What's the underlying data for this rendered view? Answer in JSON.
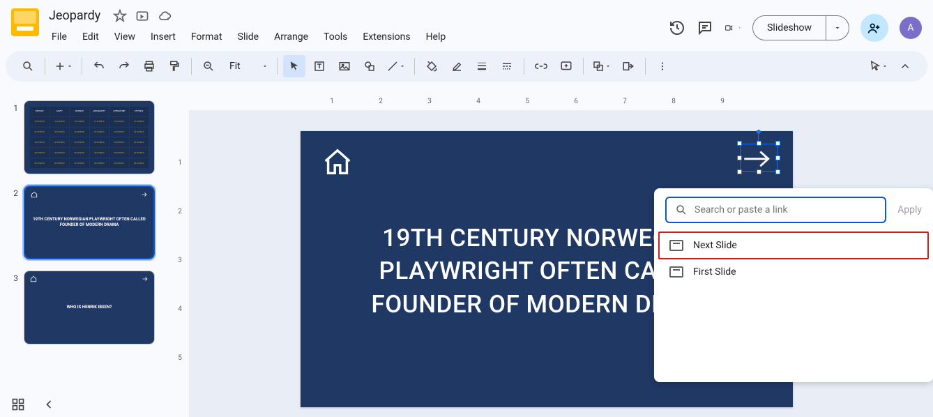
{
  "doc": {
    "title": "Jeopardy"
  },
  "menu": {
    "items": [
      "File",
      "Edit",
      "View",
      "Insert",
      "Format",
      "Slide",
      "Arrange",
      "Tools",
      "Extensions",
      "Help"
    ]
  },
  "header": {
    "slideshow": "Slideshow",
    "avatar_letter": "A"
  },
  "toolbar": {
    "zoom": "Fit"
  },
  "filmstrip": {
    "slides": [
      {
        "num": "1",
        "type": "board",
        "categories": [
          "HISTORY",
          "MATH",
          "SCIENCE",
          "GEOGRAPHY",
          "LITERATURE",
          "PHYSICS"
        ],
        "points": [
          "10 POINTS",
          "20 POINTS",
          "30 POINTS",
          "40 POINTS",
          "50 POINTS"
        ]
      },
      {
        "num": "2",
        "type": "clue",
        "text": "19TH CENTURY NORWEGIAN PLAYWRIGHT OFTEN CALLED FOUNDER OF MODERN DRAMA",
        "selected": true
      },
      {
        "num": "3",
        "type": "answer",
        "text": "WHO IS HENRIK IBSEN?"
      }
    ]
  },
  "slide": {
    "title_text": "19TH CENTURY NORWEGIAN PLAYWRIGHT OFTEN CALLED FOUNDER OF MODERN DRAMA"
  },
  "ruler_h": [
    "1",
    "2",
    "3",
    "4",
    "5",
    "6",
    "7",
    "8",
    "9"
  ],
  "ruler_v": [
    "1",
    "2",
    "3",
    "4",
    "5"
  ],
  "link_popup": {
    "placeholder": "Search or paste a link",
    "apply": "Apply",
    "options": [
      "Next Slide",
      "First Slide"
    ]
  }
}
